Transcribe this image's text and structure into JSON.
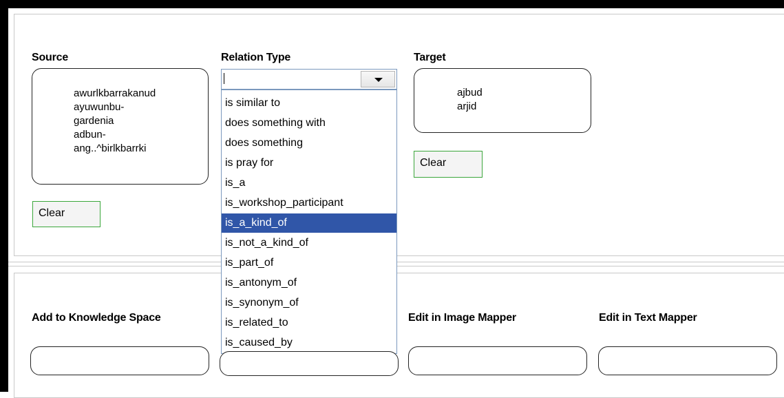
{
  "source": {
    "label": "Source",
    "lines": [
      "awurlkbarrakanud",
      "ayuwunbu-",
      "gardenia",
      "adbun-",
      "ang..^birlkbarrki"
    ],
    "clear_label": "Clear"
  },
  "relation": {
    "label": "Relation Type",
    "value": "",
    "options": [
      "is similar to",
      "does something with",
      "does something",
      "is pray for",
      "is_a",
      "is_workshop_participant",
      "is_a_kind_of",
      "is_not_a_kind_of",
      "is_part_of",
      "is_antonym_of",
      "is_synonym_of",
      "is_related_to",
      "is_caused_by"
    ],
    "highlighted": "is_a_kind_of"
  },
  "target": {
    "label": "Target",
    "lines": [
      "ajbud",
      "arjid"
    ],
    "clear_label": "Clear"
  },
  "bottom": {
    "add_label": "Add to Knowledge Space",
    "col2_label": "",
    "image_mapper_label": "Edit in Image Mapper",
    "text_mapper_label": "Edit in Text Mapper"
  }
}
